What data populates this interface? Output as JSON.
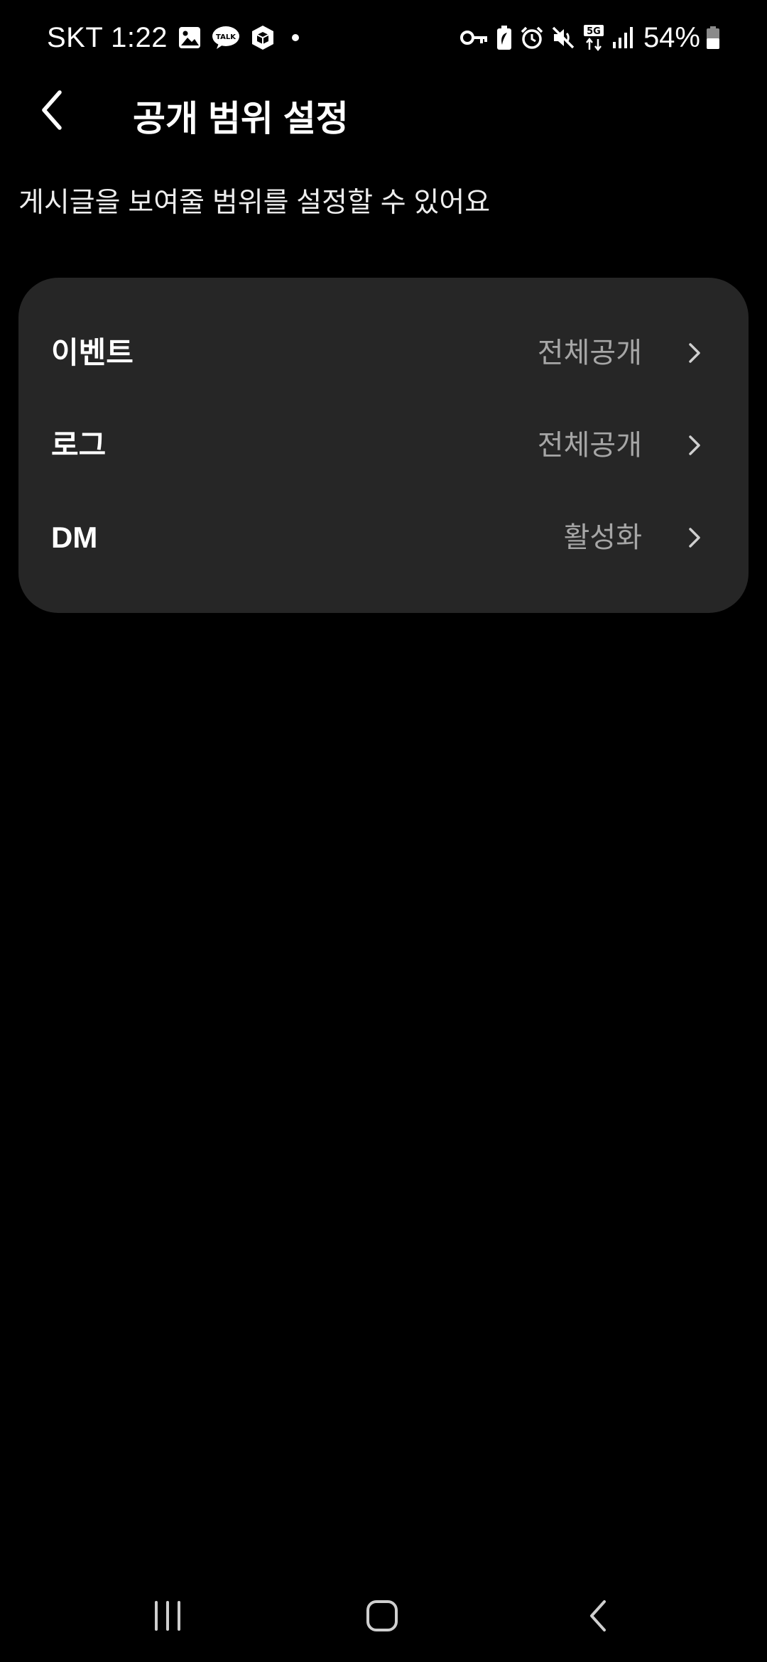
{
  "status_bar": {
    "carrier_time": "SKT 1:22",
    "battery_percent": "54%",
    "left_icons": [
      "gallery-icon",
      "kakaotalk-icon",
      "box-app-icon",
      "notification-dot-icon"
    ],
    "right_icons": [
      "vpn-key-icon",
      "battery-saver-icon",
      "alarm-icon",
      "mute-icon",
      "5g-data-icon",
      "signal-icon",
      "battery-icon"
    ]
  },
  "header": {
    "title": "공개 범위 설정"
  },
  "description": "게시글을 보여줄 범위를 설정할 수 있어요",
  "settings": {
    "items": [
      {
        "label": "이벤트",
        "value": "전체공개"
      },
      {
        "label": "로그",
        "value": "전체공개"
      },
      {
        "label": "DM",
        "value": "활성화"
      }
    ]
  },
  "colors": {
    "background": "#000000",
    "card": "#262626",
    "primary_text": "#ffffff",
    "secondary_text": "#a6a6a6"
  }
}
